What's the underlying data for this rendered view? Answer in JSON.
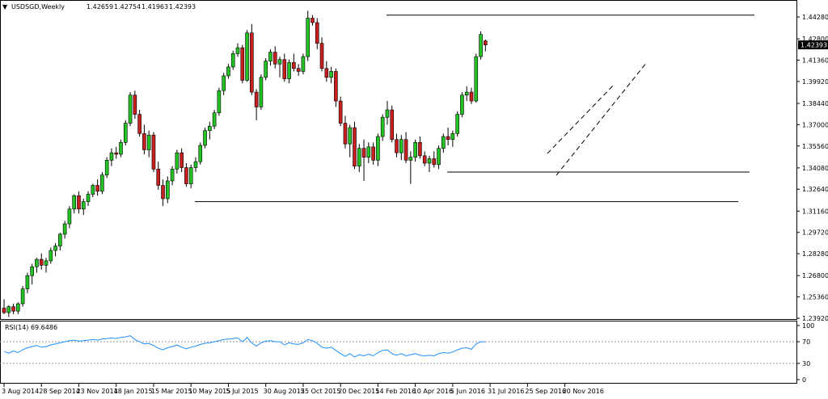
{
  "chart_header": {
    "symbol": "USDSGD,Weekly",
    "open": "1.42659",
    "high": "1.42754",
    "low": "1.41963",
    "close": "1.42393"
  },
  "current_price_label": "1.42393",
  "rsi_header": "RSI(14) 69.6486",
  "chart_data": [
    {
      "type": "candlestick",
      "title": "USDSGD,Weekly",
      "xlabel": "",
      "ylabel": "",
      "ylim": [
        1.2392,
        1.4428
      ],
      "y_ticks": [
        "1.44280",
        "1.42800",
        "1.41360",
        "1.39920",
        "1.38440",
        "1.37000",
        "1.35560",
        "1.34080",
        "1.32640",
        "1.31160",
        "1.29720",
        "1.28280",
        "1.26800",
        "1.25360",
        "1.23920"
      ],
      "x_tick_labels": [
        "3 Aug 2014",
        "28 Sep 2014",
        "23 Nov 2014",
        "18 Jan 2015",
        "15 Mar 2015",
        "10 May 2015",
        "5 Jul 2015",
        "30 Aug 2015",
        "25 Oct 2015",
        "20 Dec 2015",
        "14 Feb 2016",
        "10 Apr 2016",
        "5 Jun 2016",
        "31 Jul 2016",
        "25 Sep 2016",
        "20 Nov 2016"
      ],
      "x_tick_positions": [
        0,
        8,
        16,
        24,
        32,
        40,
        48,
        56,
        64,
        72,
        80,
        88,
        96,
        104,
        112,
        120
      ],
      "ohlc": [
        [
          1.246,
          1.252,
          1.242,
          1.243
        ],
        [
          1.243,
          1.248,
          1.24,
          1.247
        ],
        [
          1.247,
          1.249,
          1.242,
          1.244
        ],
        [
          1.244,
          1.25,
          1.242,
          1.249
        ],
        [
          1.249,
          1.261,
          1.247,
          1.259
        ],
        [
          1.259,
          1.27,
          1.256,
          1.268
        ],
        [
          1.268,
          1.276,
          1.262,
          1.274
        ],
        [
          1.274,
          1.28,
          1.27,
          1.279
        ],
        [
          1.279,
          1.283,
          1.272,
          1.275
        ],
        [
          1.275,
          1.28,
          1.27,
          1.278
        ],
        [
          1.278,
          1.287,
          1.276,
          1.285
        ],
        [
          1.285,
          1.29,
          1.281,
          1.288
        ],
        [
          1.288,
          1.297,
          1.285,
          1.296
        ],
        [
          1.296,
          1.305,
          1.293,
          1.303
        ],
        [
          1.303,
          1.315,
          1.3,
          1.313
        ],
        [
          1.313,
          1.323,
          1.31,
          1.322
        ],
        [
          1.322,
          1.325,
          1.31,
          1.313
        ],
        [
          1.313,
          1.32,
          1.309,
          1.318
        ],
        [
          1.318,
          1.325,
          1.315,
          1.323
        ],
        [
          1.323,
          1.33,
          1.321,
          1.329
        ],
        [
          1.329,
          1.333,
          1.322,
          1.325
        ],
        [
          1.325,
          1.338,
          1.323,
          1.336
        ],
        [
          1.336,
          1.348,
          1.334,
          1.346
        ],
        [
          1.346,
          1.354,
          1.342,
          1.351
        ],
        [
          1.351,
          1.355,
          1.347,
          1.35
        ],
        [
          1.35,
          1.36,
          1.348,
          1.358
        ],
        [
          1.358,
          1.373,
          1.356,
          1.371
        ],
        [
          1.371,
          1.392,
          1.369,
          1.39
        ],
        [
          1.39,
          1.393,
          1.374,
          1.377
        ],
        [
          1.377,
          1.38,
          1.362,
          1.364
        ],
        [
          1.364,
          1.37,
          1.35,
          1.353
        ],
        [
          1.353,
          1.366,
          1.348,
          1.363
        ],
        [
          1.363,
          1.365,
          1.338,
          1.34
        ],
        [
          1.34,
          1.345,
          1.326,
          1.329
        ],
        [
          1.329,
          1.333,
          1.315,
          1.32
        ],
        [
          1.32,
          1.335,
          1.317,
          1.332
        ],
        [
          1.332,
          1.342,
          1.329,
          1.34
        ],
        [
          1.34,
          1.353,
          1.337,
          1.351
        ],
        [
          1.351,
          1.354,
          1.338,
          1.341
        ],
        [
          1.341,
          1.344,
          1.328,
          1.33
        ],
        [
          1.33,
          1.343,
          1.327,
          1.341
        ],
        [
          1.341,
          1.348,
          1.338,
          1.345
        ],
        [
          1.345,
          1.358,
          1.343,
          1.356
        ],
        [
          1.356,
          1.368,
          1.354,
          1.366
        ],
        [
          1.366,
          1.372,
          1.36,
          1.369
        ],
        [
          1.369,
          1.38,
          1.367,
          1.378
        ],
        [
          1.378,
          1.395,
          1.376,
          1.393
        ],
        [
          1.393,
          1.405,
          1.39,
          1.403
        ],
        [
          1.403,
          1.411,
          1.401,
          1.409
        ],
        [
          1.409,
          1.42,
          1.407,
          1.418
        ],
        [
          1.418,
          1.425,
          1.416,
          1.422
        ],
        [
          1.422,
          1.424,
          1.398,
          1.4
        ],
        [
          1.4,
          1.434,
          1.399,
          1.432
        ],
        [
          1.432,
          1.438,
          1.39,
          1.392
        ],
        [
          1.392,
          1.394,
          1.373,
          1.382
        ],
        [
          1.382,
          1.404,
          1.38,
          1.402
        ],
        [
          1.402,
          1.415,
          1.4,
          1.413
        ],
        [
          1.413,
          1.421,
          1.41,
          1.419
        ],
        [
          1.419,
          1.423,
          1.408,
          1.411
        ],
        [
          1.411,
          1.416,
          1.402,
          1.414
        ],
        [
          1.414,
          1.418,
          1.399,
          1.401
        ],
        [
          1.401,
          1.414,
          1.398,
          1.412
        ],
        [
          1.412,
          1.418,
          1.406,
          1.408
        ],
        [
          1.408,
          1.411,
          1.403,
          1.406
        ],
        [
          1.406,
          1.418,
          1.404,
          1.416
        ],
        [
          1.416,
          1.447,
          1.413,
          1.442
        ],
        [
          1.442,
          1.444,
          1.437,
          1.439
        ],
        [
          1.439,
          1.442,
          1.421,
          1.425
        ],
        [
          1.425,
          1.429,
          1.406,
          1.408
        ],
        [
          1.408,
          1.413,
          1.399,
          1.402
        ],
        [
          1.402,
          1.409,
          1.398,
          1.406
        ],
        [
          1.406,
          1.408,
          1.382,
          1.386
        ],
        [
          1.386,
          1.389,
          1.369,
          1.371
        ],
        [
          1.371,
          1.376,
          1.354,
          1.357
        ],
        [
          1.357,
          1.37,
          1.348,
          1.368
        ],
        [
          1.368,
          1.372,
          1.34,
          1.342
        ],
        [
          1.342,
          1.357,
          1.338,
          1.354
        ],
        [
          1.354,
          1.36,
          1.332,
          1.348
        ],
        [
          1.348,
          1.358,
          1.344,
          1.355
        ],
        [
          1.355,
          1.358,
          1.343,
          1.346
        ],
        [
          1.346,
          1.364,
          1.342,
          1.362
        ],
        [
          1.362,
          1.377,
          1.359,
          1.375
        ],
        [
          1.375,
          1.386,
          1.37,
          1.38
        ],
        [
          1.38,
          1.383,
          1.358,
          1.36
        ],
        [
          1.36,
          1.364,
          1.348,
          1.351
        ],
        [
          1.351,
          1.363,
          1.346,
          1.36
        ],
        [
          1.36,
          1.365,
          1.344,
          1.346
        ],
        [
          1.346,
          1.352,
          1.33,
          1.348
        ],
        [
          1.348,
          1.36,
          1.345,
          1.358
        ],
        [
          1.358,
          1.362,
          1.347,
          1.349
        ],
        [
          1.349,
          1.352,
          1.342,
          1.344
        ],
        [
          1.344,
          1.349,
          1.338,
          1.347
        ],
        [
          1.347,
          1.352,
          1.341,
          1.343
        ],
        [
          1.343,
          1.356,
          1.34,
          1.354
        ],
        [
          1.354,
          1.364,
          1.351,
          1.362
        ],
        [
          1.362,
          1.368,
          1.356,
          1.36
        ],
        [
          1.36,
          1.366,
          1.355,
          1.364
        ],
        [
          1.364,
          1.379,
          1.362,
          1.377
        ],
        [
          1.377,
          1.392,
          1.375,
          1.39
        ],
        [
          1.39,
          1.396,
          1.386,
          1.392
        ],
        [
          1.392,
          1.395,
          1.384,
          1.386
        ],
        [
          1.386,
          1.418,
          1.385,
          1.416
        ],
        [
          1.416,
          1.433,
          1.414,
          1.431
        ],
        [
          1.4266,
          1.4275,
          1.4196,
          1.4239
        ]
      ],
      "horizontal_levels": [
        1.444,
        1.338,
        1.318
      ],
      "annotations": [
        "1.42393"
      ]
    },
    {
      "type": "line",
      "title": "RSI(14) 69.6486",
      "xlabel": "",
      "ylabel": "",
      "ylim": [
        0,
        100
      ],
      "y_ticks": [
        "100",
        "70",
        "30",
        "0"
      ],
      "levels": [
        70,
        30
      ],
      "series": [
        {
          "values": [
            52,
            49,
            53,
            50,
            55,
            59,
            61,
            63,
            60,
            61,
            64,
            66,
            68,
            70,
            72,
            73,
            71,
            72,
            73,
            74,
            73,
            75,
            76,
            77,
            76,
            78,
            79,
            81,
            74,
            70,
            66,
            67,
            63,
            58,
            55,
            59,
            61,
            64,
            60,
            57,
            60,
            62,
            65,
            67,
            68,
            70,
            72,
            74,
            75,
            76,
            77,
            70,
            78,
            68,
            62,
            68,
            71,
            72,
            70,
            70,
            64,
            68,
            66,
            65,
            68,
            74,
            72,
            67,
            60,
            58,
            60,
            54,
            48,
            43,
            48,
            42,
            46,
            44,
            47,
            44,
            50,
            54,
            55,
            48,
            45,
            48,
            44,
            46,
            48,
            45,
            44,
            45,
            44,
            48,
            50,
            49,
            51,
            55,
            58,
            59,
            56,
            66,
            70,
            69.6486
          ]
        }
      ]
    }
  ]
}
